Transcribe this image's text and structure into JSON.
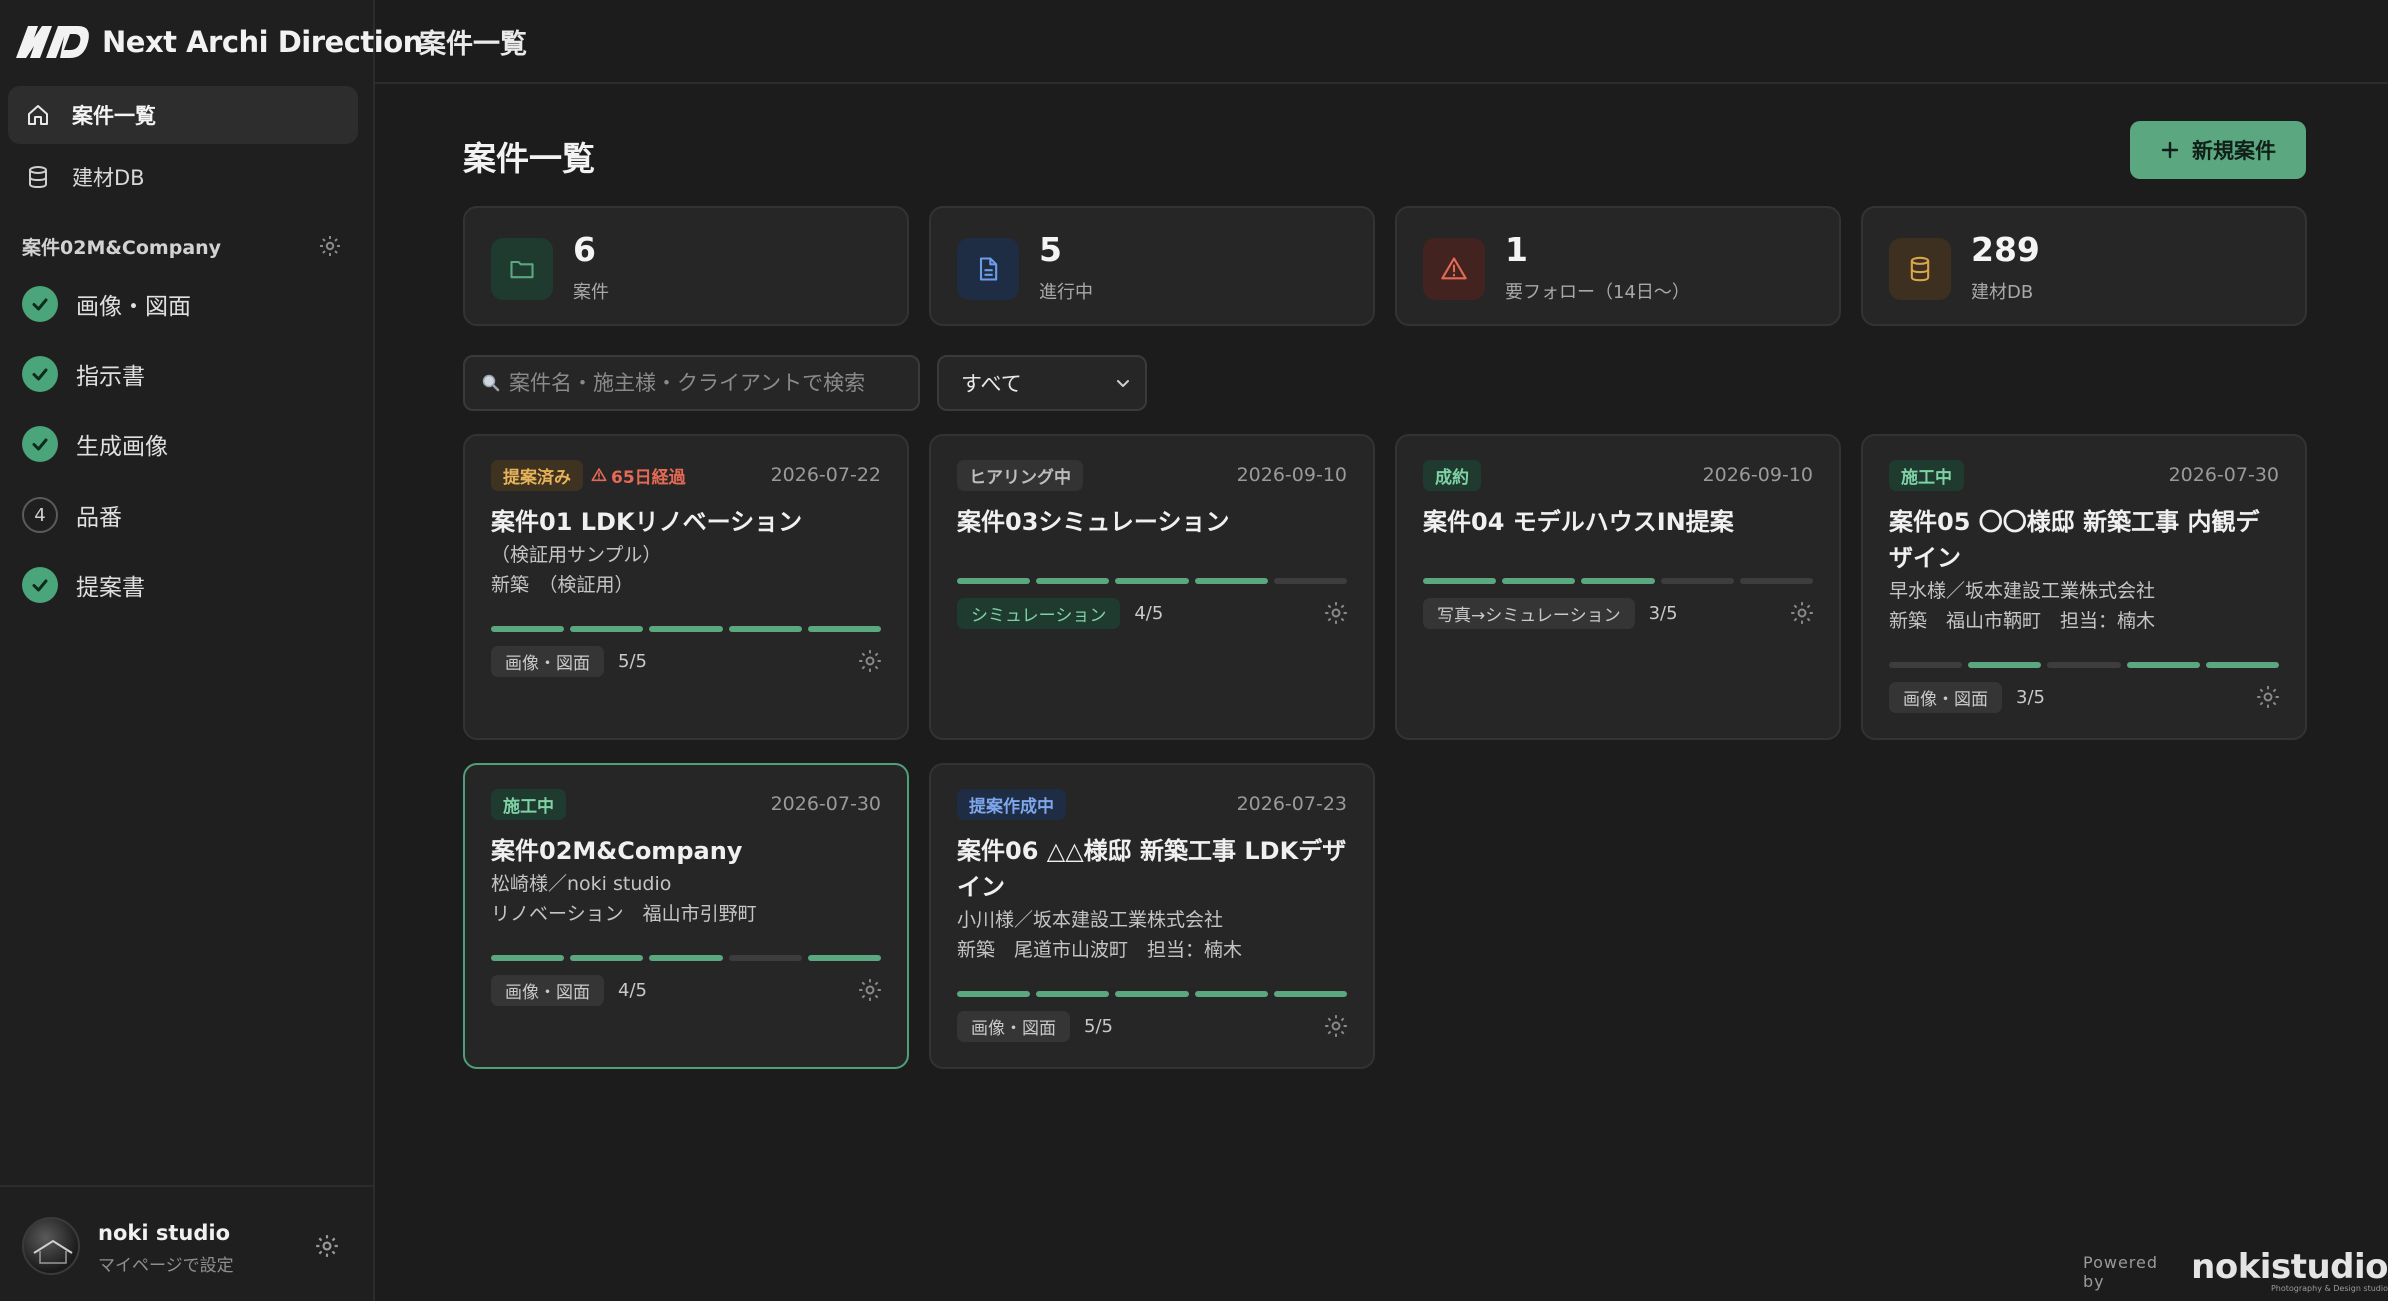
{
  "app": {
    "logo_text": "Next Archi Direction"
  },
  "sidebar": {
    "nav": [
      {
        "label": "案件一覧",
        "active": true
      },
      {
        "label": "建材DB",
        "active": false
      }
    ],
    "project_name": "案件02M&Company",
    "steps": [
      {
        "label": "画像・図面",
        "done": true
      },
      {
        "label": "指示書",
        "done": true
      },
      {
        "label": "生成画像",
        "done": true
      },
      {
        "label": "品番",
        "done": false,
        "number": "4"
      },
      {
        "label": "提案書",
        "done": true
      }
    ],
    "user": {
      "name": "noki studio",
      "sub": "マイページで設定"
    }
  },
  "header": {
    "title": "案件一覧"
  },
  "main": {
    "title": "案件一覧",
    "new_button": "新規案件",
    "stats": [
      {
        "value": "6",
        "label": "案件",
        "icon": "folder-icon",
        "color": "#5aa780",
        "bg": "#1f3a2e"
      },
      {
        "value": "5",
        "label": "進行中",
        "icon": "document-icon",
        "color": "#6c9ee8",
        "bg": "#1e2c44"
      },
      {
        "value": "1",
        "label": "要フォロー（14日〜）",
        "icon": "warning-icon",
        "color": "#e56a56",
        "bg": "#43231f"
      },
      {
        "value": "289",
        "label": "建材DB",
        "icon": "database-icon",
        "color": "#d9a54a",
        "bg": "#3d3020"
      }
    ],
    "search": {
      "placeholder": "案件名・施主様・クライアントで検索"
    },
    "filter": {
      "selected": "すべて"
    },
    "cards": [
      {
        "status": "提案済み",
        "status_fg": "#e6b35a",
        "status_bg": "#3e3220",
        "warning": "65日経過",
        "date": "2026-07-22",
        "title": "案件01 LDKリノベーション",
        "lines": [
          "（検証用サンプル）",
          "新築　（検証用）"
        ],
        "progress": [
          1,
          1,
          1,
          1,
          1
        ],
        "phase": "画像・図面",
        "phase_green": false,
        "count": "5/5",
        "selected": false
      },
      {
        "status": "ヒアリング中",
        "status_fg": "#bdbdbd",
        "status_bg": "#333333",
        "warning": "",
        "date": "2026-09-10",
        "title": "案件03シミュレーション",
        "lines": [],
        "progress": [
          1,
          1,
          1,
          1,
          0
        ],
        "phase": "シミュレーション",
        "phase_green": true,
        "count": "4/5",
        "selected": false
      },
      {
        "status": "成約",
        "status_fg": "#7fd2a6",
        "status_bg": "#1f3a2e",
        "warning": "",
        "date": "2026-09-10",
        "title": "案件04 モデルハウスIN提案",
        "lines": [],
        "progress": [
          1,
          1,
          1,
          0,
          0
        ],
        "phase": "写真→シミュレーション",
        "phase_green": false,
        "count": "3/5",
        "selected": false
      },
      {
        "status": "施工中",
        "status_fg": "#7fd2a6",
        "status_bg": "#1f3a2e",
        "warning": "",
        "date": "2026-07-30",
        "title": "案件05 〇〇様邸 新築工事 内観デザイン",
        "lines": [
          "早水様／坂本建設工業株式会社",
          "新築　福山市鞆町　担当：楠木"
        ],
        "progress": [
          0,
          1,
          0,
          1,
          1
        ],
        "phase": "画像・図面",
        "phase_green": false,
        "count": "3/5",
        "selected": false
      },
      {
        "status": "施工中",
        "status_fg": "#7fd2a6",
        "status_bg": "#1f3a2e",
        "warning": "",
        "date": "2026-07-30",
        "title": "案件02M&Company",
        "lines": [
          "松崎様／noki studio",
          "リノベーション　福山市引野町"
        ],
        "progress": [
          1,
          1,
          1,
          0,
          1
        ],
        "phase": "画像・図面",
        "phase_green": false,
        "count": "4/5",
        "selected": true
      },
      {
        "status": "提案作成中",
        "status_fg": "#7ea6ea",
        "status_bg": "#1e2c44",
        "warning": "",
        "date": "2026-07-23",
        "title": "案件06 △△様邸 新築工事 LDKデザイン",
        "lines": [
          "小川様／坂本建設工業株式会社",
          "新築　尾道市山波町　担当：楠木"
        ],
        "progress": [
          1,
          1,
          1,
          1,
          1
        ],
        "phase": "画像・図面",
        "phase_green": false,
        "count": "5/5",
        "selected": false
      }
    ]
  },
  "footer": {
    "powered_by": "Powered by",
    "brand": "nokistudio",
    "brand_sub": "Photography & Design studio"
  }
}
